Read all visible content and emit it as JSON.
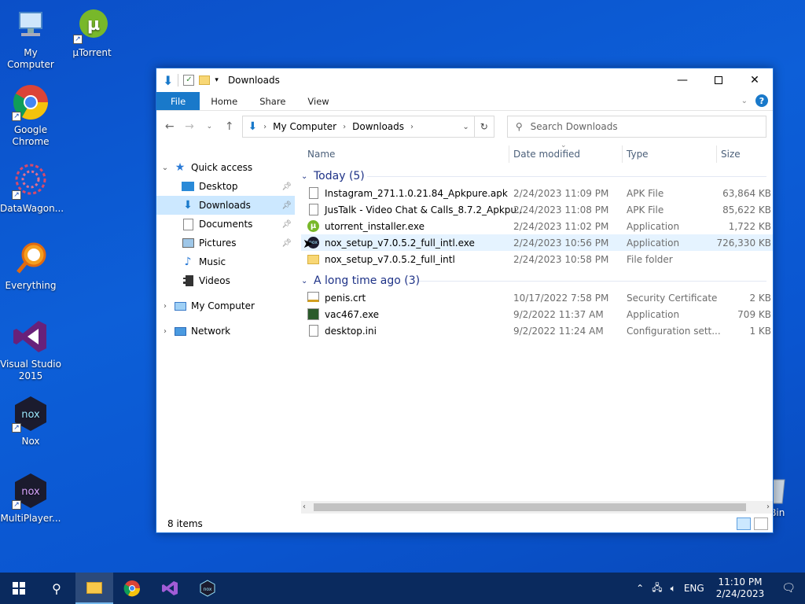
{
  "desktop": {
    "icons": [
      {
        "label": "My Computer"
      },
      {
        "label": "µTorrent"
      },
      {
        "label": "Google Chrome"
      },
      {
        "label": "DataWagon..."
      },
      {
        "label": "Everything"
      },
      {
        "label": "Visual Studio 2015"
      },
      {
        "label": "Nox"
      },
      {
        "label": "MultiPlayer..."
      }
    ],
    "recycle_label": "e Bin"
  },
  "window": {
    "title": "Downloads",
    "tabs": {
      "file": "File",
      "home": "Home",
      "share": "Share",
      "view": "View"
    },
    "address": {
      "root": "My Computer",
      "current": "Downloads"
    },
    "search_placeholder": "Search Downloads"
  },
  "nav": {
    "quick_access": "Quick access",
    "items": [
      {
        "label": "Desktop"
      },
      {
        "label": "Downloads"
      },
      {
        "label": "Documents"
      },
      {
        "label": "Pictures"
      },
      {
        "label": "Music"
      },
      {
        "label": "Videos"
      }
    ],
    "my_computer": "My Computer",
    "network": "Network"
  },
  "columns": {
    "name": "Name",
    "date": "Date modified",
    "type": "Type",
    "size": "Size"
  },
  "groups": [
    {
      "label": "Today (5)",
      "files": [
        {
          "name": "Instagram_271.1.0.21.84_Apkpure.apk",
          "date": "2/24/2023 11:09 PM",
          "type": "APK File",
          "size": "63,864 KB"
        },
        {
          "name": "JusTalk - Video Chat & Calls_8.7.2_Apkpu...",
          "date": "2/24/2023 11:08 PM",
          "type": "APK File",
          "size": "85,622 KB"
        },
        {
          "name": "utorrent_installer.exe",
          "date": "2/24/2023 11:02 PM",
          "type": "Application",
          "size": "1,722 KB"
        },
        {
          "name": "nox_setup_v7.0.5.2_full_intl.exe",
          "date": "2/24/2023 10:56 PM",
          "type": "Application",
          "size": "726,330 KB"
        },
        {
          "name": "nox_setup_v7.0.5.2_full_intl",
          "date": "2/24/2023 10:58 PM",
          "type": "File folder",
          "size": ""
        }
      ]
    },
    {
      "label": "A long time ago (3)",
      "files": [
        {
          "name": "penis.crt",
          "date": "10/17/2022 7:58 PM",
          "type": "Security Certificate",
          "size": "2 KB"
        },
        {
          "name": "vac467.exe",
          "date": "9/2/2022 11:37 AM",
          "type": "Application",
          "size": "709 KB"
        },
        {
          "name": "desktop.ini",
          "date": "9/2/2022 11:24 AM",
          "type": "Configuration sett...",
          "size": "1 KB"
        }
      ]
    }
  ],
  "status": {
    "items": "8 items"
  },
  "taskbar": {
    "lang": "ENG",
    "time": "11:10 PM",
    "date": "2/24/2023"
  },
  "colors": {
    "accent": "#1979ca",
    "desktop": "#0d5fd8",
    "taskbar": "#0a2a5e",
    "selected": "#cce8ff"
  }
}
